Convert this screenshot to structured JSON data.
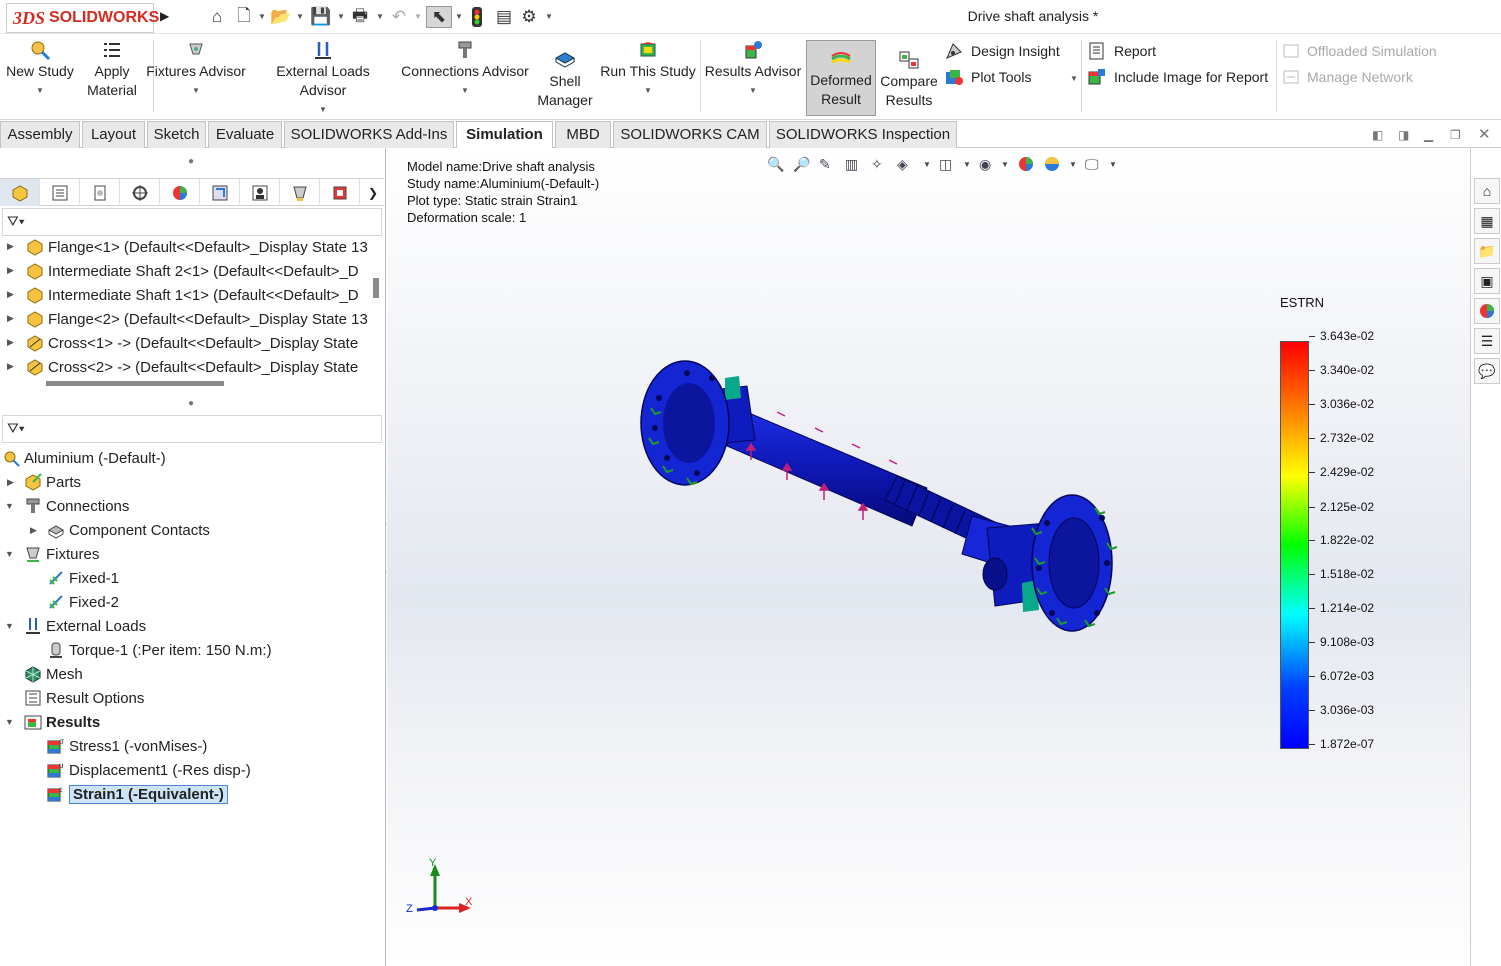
{
  "app": {
    "logo_ds": "3DS",
    "logo_text": "SOLIDWORKS",
    "doc_title": "Drive shaft analysis *"
  },
  "quick_access": [
    "home-icon",
    "new-doc-icon",
    "open-icon",
    "save-icon",
    "print-icon",
    "undo-icon",
    "select-icon",
    "rebuild-icon",
    "file-properties-icon",
    "options-icon"
  ],
  "ribbon": {
    "new_study": "New Study",
    "apply_material_1": "Apply",
    "apply_material_2": "Material",
    "fixtures_advisor": "Fixtures Advisor",
    "external_loads_advisor": "External Loads Advisor",
    "connections_advisor": "Connections Advisor",
    "shell_manager_1": "Shell",
    "shell_manager_2": "Manager",
    "run_this_study": "Run This Study",
    "results_advisor": "Results Advisor",
    "deformed_result_1": "Deformed",
    "deformed_result_2": "Result",
    "compare_results_1": "Compare",
    "compare_results_2": "Results",
    "design_insight": "Design Insight",
    "plot_tools": "Plot Tools",
    "report": "Report",
    "include_image": "Include Image for Report",
    "offloaded_simulation": "Offloaded Simulation",
    "manage_network": "Manage Network"
  },
  "tabs": [
    "Assembly",
    "Layout",
    "Sketch",
    "Evaluate",
    "SOLIDWORKS Add-Ins",
    "Simulation",
    "MBD",
    "SOLIDWORKS CAM",
    "SOLIDWORKS Inspection"
  ],
  "active_tab": "Simulation",
  "feature_tree": {
    "items": [
      "Flange<1> (Default<<Default>_Display State 13",
      "Intermediate Shaft 2<1> (Default<<Default>_D",
      "Intermediate Shaft 1<1> (Default<<Default>_D",
      "Flange<2> (Default<<Default>_Display State 13",
      "Cross<1> -> (Default<<Default>_Display State",
      "Cross<2> -> (Default<<Default>_Display State"
    ]
  },
  "study_tree": {
    "study": "Aluminium (-Default-)",
    "parts": "Parts",
    "connections": "Connections",
    "component_contacts": "Component Contacts",
    "fixtures": "Fixtures",
    "fixed1": "Fixed-1",
    "fixed2": "Fixed-2",
    "external_loads": "External Loads",
    "torque": "Torque-1 (:Per item: 150 N.m:)",
    "mesh": "Mesh",
    "result_options": "Result Options",
    "results": "Results",
    "stress": "Stress1 (-vonMises-)",
    "displacement": "Displacement1 (-Res disp-)",
    "strain": "Strain1 (-Equivalent-)"
  },
  "viewport": {
    "model_name": "Model name:Drive shaft analysis",
    "study_name": "Study name:Aluminium(-Default-)",
    "plot_type": "Plot type: Static strain Strain1",
    "deformation_scale": "Deformation scale: 1"
  },
  "legend": {
    "title": "ESTRN",
    "labels": [
      "3.643e-02",
      "3.340e-02",
      "3.036e-02",
      "2.732e-02",
      "2.429e-02",
      "2.125e-02",
      "1.822e-02",
      "1.518e-02",
      "1.214e-02",
      "9.108e-03",
      "6.072e-03",
      "3.036e-03",
      "1.872e-07"
    ]
  },
  "triad": {
    "x": "X",
    "y": "Y",
    "z": "Z"
  }
}
